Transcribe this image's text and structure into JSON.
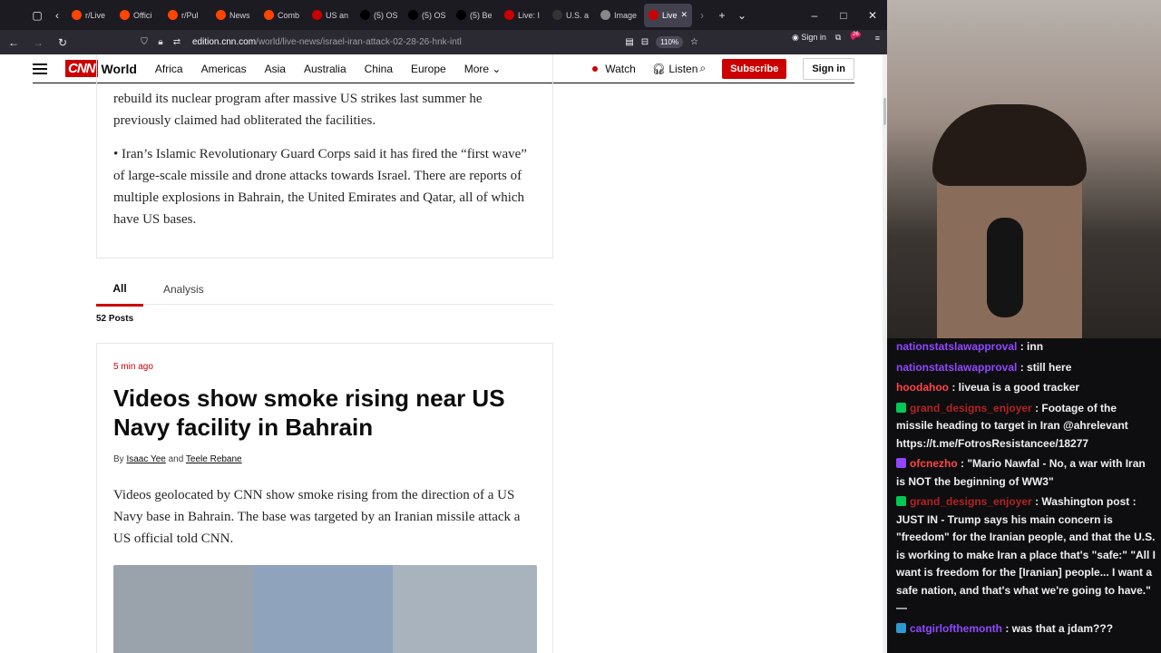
{
  "browser": {
    "tabs": [
      {
        "label": "r/Live",
        "color": "#ff4500"
      },
      {
        "label": "Offici",
        "color": "#ff4500"
      },
      {
        "label": "r/Pul",
        "color": "#ff4500"
      },
      {
        "label": "News",
        "color": "#ff4500"
      },
      {
        "label": "Comb",
        "color": "#ff4500"
      },
      {
        "label": "US an",
        "color": "#c00"
      },
      {
        "label": "(5) OS",
        "color": "#000"
      },
      {
        "label": "(5) OS",
        "color": "#000"
      },
      {
        "label": "(5) Be",
        "color": "#000"
      },
      {
        "label": "Live: I",
        "color": "#cc0000"
      },
      {
        "label": "U.S. a",
        "color": "#333"
      },
      {
        "label": "Image",
        "color": "#888"
      },
      {
        "label": "Live",
        "color": "#cc0000"
      }
    ],
    "url_domain": "edition.cnn.com",
    "url_path": "/world/live-news/israel-iran-attack-02-28-26-hnk-intl",
    "zoom": "110%",
    "sign_in": "Sign in",
    "extension_badge": "26"
  },
  "cnn": {
    "logo": "CNN",
    "section": "World",
    "nav": [
      "Africa",
      "Americas",
      "Asia",
      "Australia",
      "China",
      "Europe",
      "More"
    ],
    "watch": "Watch",
    "listen": "Listen",
    "subscribe": "Subscribe",
    "signin": "Sign in"
  },
  "article": {
    "p1": "rebuild its nuclear program after massive US strikes last summer he previously claimed had obliterated the facilities.",
    "p2": "• Iran’s Islamic Revolutionary Guard Corps said it has fired the “first wave” of large-scale missile and drone attacks towards Israel. There are reports of multiple explosions in Bahrain, the United Emirates and Qatar, all of which have US bases.",
    "tab_all": "All",
    "tab_analysis": "Analysis",
    "posts_count": "52 Posts",
    "post": {
      "timestamp": "5 min ago",
      "headline": "Videos show smoke rising near US Navy facility in Bahrain",
      "by": "By",
      "author1": "Isaac Yee",
      "and": "and",
      "author2": "Teele Rebane",
      "body": "Videos geolocated by CNN show smoke rising from the direction of a US Navy base in Bahrain. The base was targeted by an Iranian missile attack a US official told CNN."
    }
  },
  "chat": [
    {
      "user": "nationstatslawapproval",
      "color": "#9147ff",
      "text": ": inn",
      "badge": ""
    },
    {
      "user": "nationstatslawapproval",
      "color": "#9147ff",
      "text": ": still here",
      "badge": ""
    },
    {
      "user": "hoodahoo",
      "color": "#ff4545",
      "text": ": liveua is a good tracker",
      "badge": ""
    },
    {
      "user": "grand_designs_enjoyer",
      "color": "#b22222",
      "text": ": Footage of the missile heading to target in Iran @ahrelevant https://t.me/FotrosResistancee/18277",
      "badge": "#00c853"
    },
    {
      "user": "ofcnezho",
      "color": "#ff4545",
      "text": ": \"Mario Nawfal - No, a war with Iran is NOT the beginning of WW3\"",
      "badge": "#9147ff"
    },
    {
      "user": "grand_designs_enjoyer",
      "color": "#b22222",
      "text": ": Washington post : JUST IN - Trump says his main concern is \"freedom\" for the Iranian people, and that the U.S. is working to make Iran a place that's \"safe:\" \"All I want is freedom for the [Iranian] people... I want a safe nation, and that's what we're going to have.\" —",
      "badge": "#00c853"
    },
    {
      "user": "catgirlofthemonth",
      "color": "#9147ff",
      "text": ": was that a jdam???",
      "badge": "#2e9ad0"
    }
  ]
}
